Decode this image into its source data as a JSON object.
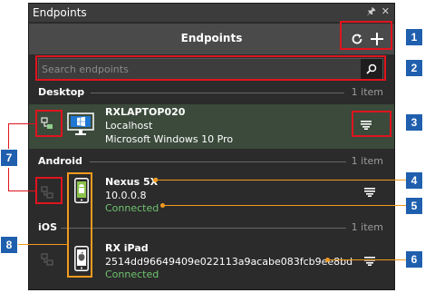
{
  "window": {
    "title": "Endpoints"
  },
  "header": {
    "title": "Endpoints"
  },
  "search": {
    "placeholder": "Search endpoints"
  },
  "sections": {
    "desktop": {
      "name": "Desktop",
      "count": "1 item"
    },
    "android": {
      "name": "Android",
      "count": "1 item"
    },
    "ios": {
      "name": "iOS",
      "count": "1 item"
    }
  },
  "devices": {
    "desktop": {
      "name": "RXLAPTOP020",
      "line2": "Localhost",
      "line3": "Microsoft Windows 10 Pro"
    },
    "android": {
      "name": "Nexus 5X",
      "line2": "10.0.0.8",
      "status": "Connected"
    },
    "ios": {
      "name": "RX iPad",
      "line2": "2514dd96649409e022113a9acabe083fcb9ee8bd",
      "status": "Connected"
    }
  },
  "callouts": [
    "1",
    "2",
    "3",
    "4",
    "5",
    "6",
    "7",
    "8"
  ],
  "colors": {
    "panel": "#2b2b2b",
    "header": "#4a4a4a",
    "selected_row": "#3b4a3b",
    "connected": "#6fc26f",
    "callout": "#1f5fae",
    "highlight_red": "#e0141e",
    "highlight_orange": "#f39a1e"
  }
}
